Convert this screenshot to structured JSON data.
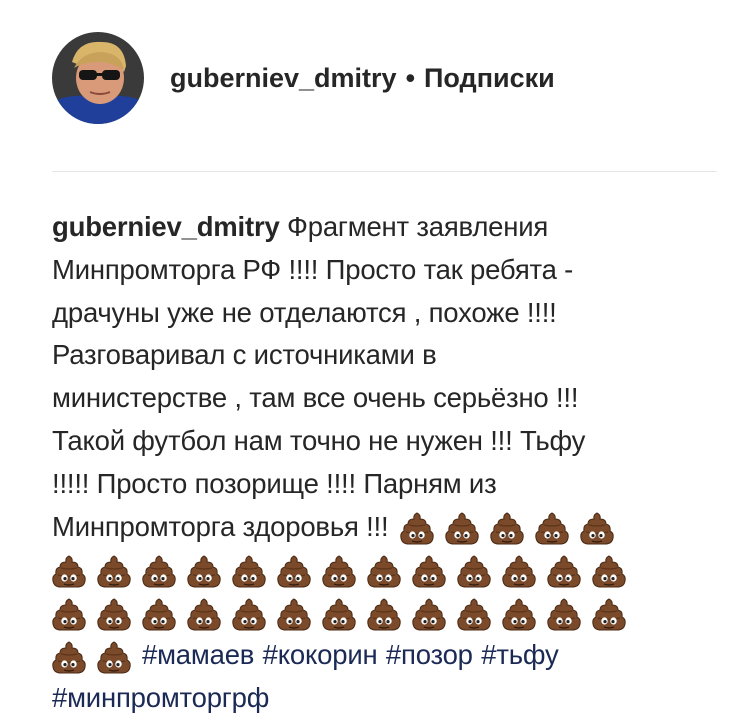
{
  "post": {
    "username": "guberniev_dmitry",
    "separator": "•",
    "follow_status": "Подписки"
  },
  "caption": {
    "username": "guberniev_dmitry",
    "lines": [
      "Фрагмент заявления",
      "Минпромторга РФ !!!! Просто так ребята -",
      "драчуны уже не отделаются , похоже !!!!",
      "Разговаривал с источниками в",
      "министерстве , там все очень серьёзно !!!",
      "Такой футбол нам точно не нужен !!! Тьфу",
      "!!!!! Просто позорище !!!! Парням из",
      "Минпромторга здоровья !!!"
    ],
    "emoji": "pile-of-poo-emoji",
    "emoji_counts": [
      5,
      13,
      13,
      2
    ],
    "hashtags": [
      "#мамаев",
      "#кокорин",
      "#позор",
      "#тьфу",
      "#минпромторгрф"
    ]
  }
}
